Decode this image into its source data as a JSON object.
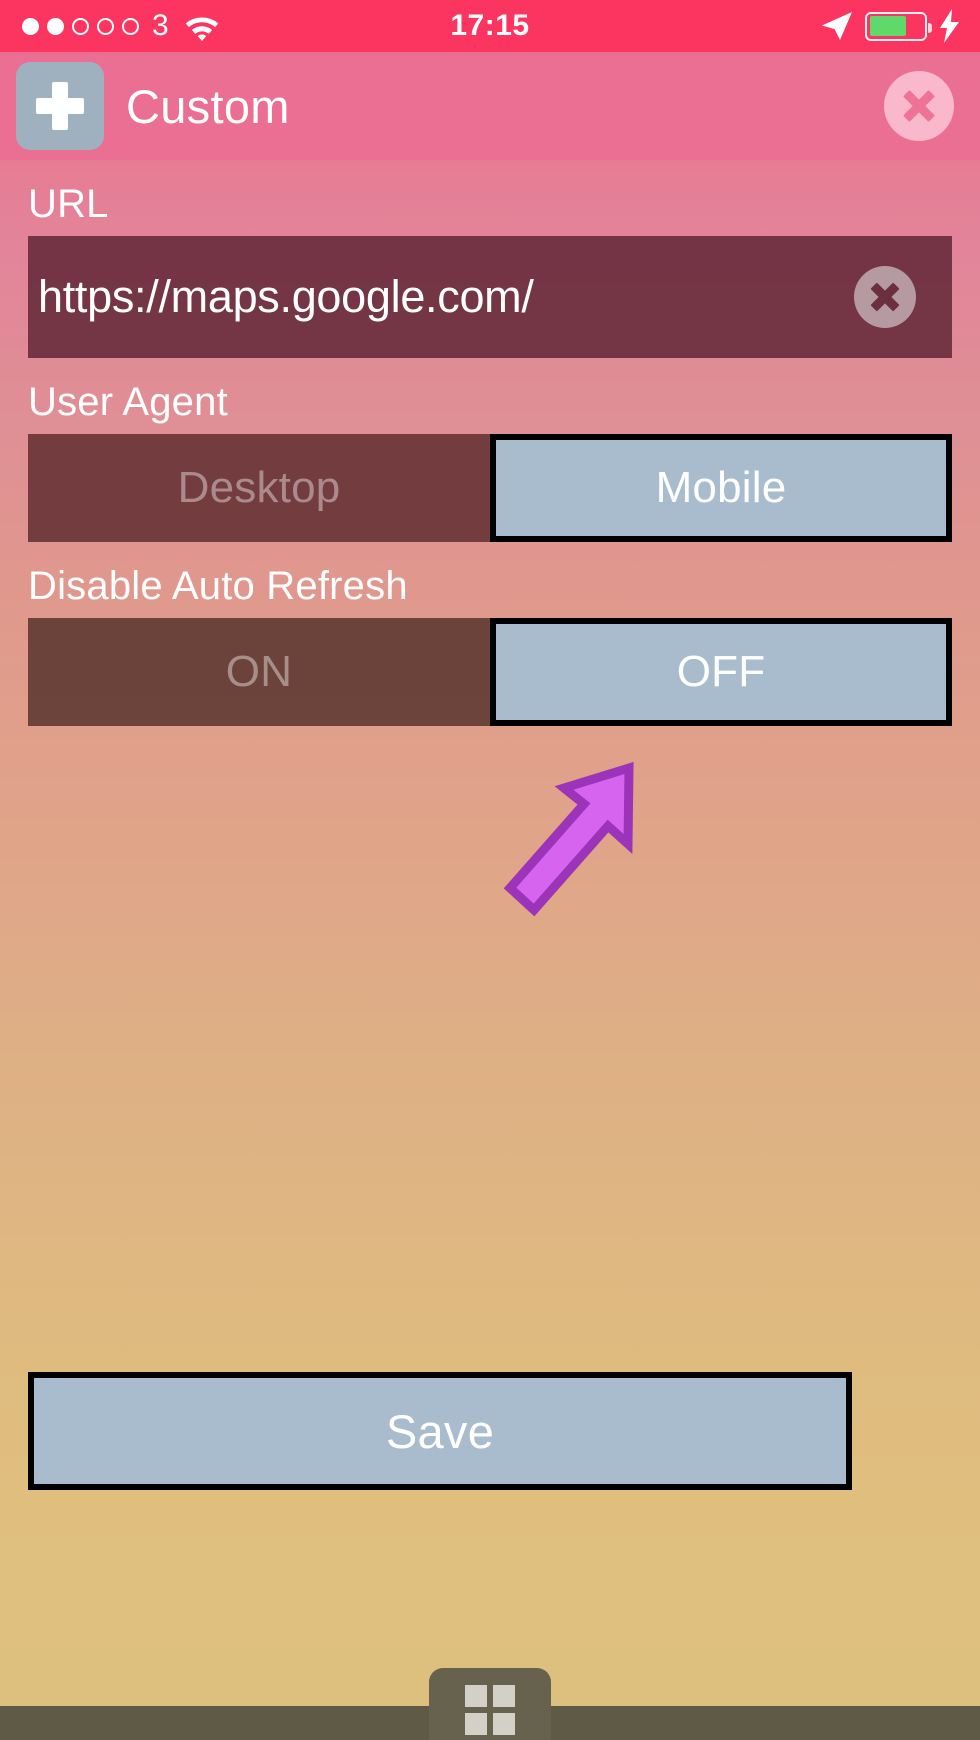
{
  "status_bar": {
    "signal_dots_total": 5,
    "signal_dots_filled": 2,
    "carrier": "3",
    "wifi_icon": "wifi-icon",
    "time": "17:15",
    "location_icon": "location-arrow-icon",
    "battery_percent": 68,
    "battery_color": "#5fd96a",
    "charging_icon": "lightning-bolt-icon",
    "background_color": "#fb3460"
  },
  "header": {
    "add_icon": "plus-icon",
    "title": "Custom",
    "close_icon": "close-circle-icon",
    "background_color": "#eb6f92",
    "tile_color": "#9fb0bf"
  },
  "form": {
    "url": {
      "label": "URL",
      "value": "https://maps.google.com/",
      "placeholder": "https://",
      "clear_icon": "clear-circle-icon"
    },
    "user_agent": {
      "label": "User Agent",
      "options": [
        "Desktop",
        "Mobile"
      ],
      "selected": "Mobile"
    },
    "disable_auto_refresh": {
      "label": "Disable Auto Refresh",
      "options": [
        "ON",
        "OFF"
      ],
      "selected": "OFF"
    }
  },
  "annotation": {
    "arrow_icon": "arrow-up-right-icon",
    "fill_color": "#d664ef",
    "stroke_color": "#9b34b8"
  },
  "save": {
    "label": "Save",
    "background_color": "#a9bccd",
    "border_color": "#000000"
  },
  "tab_bar": {
    "grid_icon": "grid-apps-icon",
    "background_color": "#5f5a46"
  },
  "theme": {
    "accent_pink": "#fb3460",
    "selected_blue_gray": "#a9bccd",
    "field_dark": "#541d2d"
  }
}
